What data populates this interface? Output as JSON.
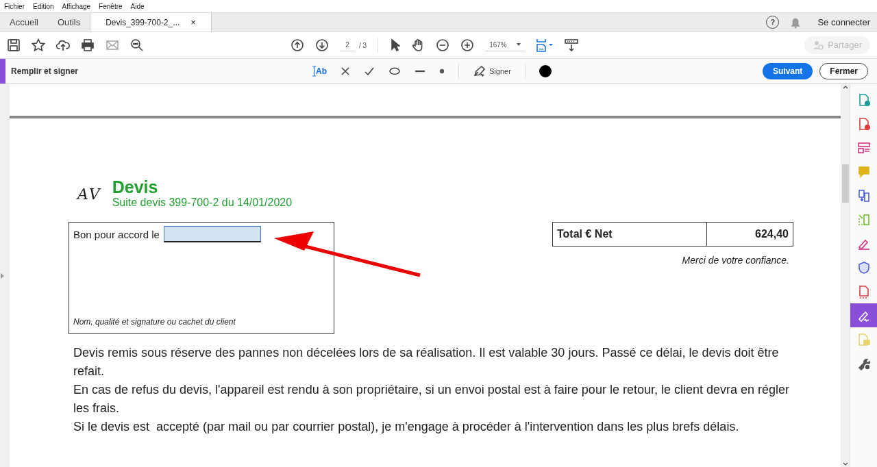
{
  "menu": [
    "Fichier",
    "Edition",
    "Affichage",
    "Fenêtre",
    "Aide"
  ],
  "tabs": [
    {
      "label": "Accueil",
      "selected": false
    },
    {
      "label": "Outils",
      "selected": false
    },
    {
      "label": "Devis_399-700-2_...",
      "selected": true,
      "close": "×"
    }
  ],
  "account": {
    "help": "?",
    "sign_in": "Se connecter"
  },
  "toolbar": {
    "page": "2",
    "page_total": "/ 3",
    "zoom": "167%",
    "share": "Partager",
    "share_disabled": true
  },
  "fill_sign": {
    "title": "Remplir et signer",
    "text_tool": "Ab",
    "sign": "Signer",
    "next": "Suivant",
    "close": "Fermer"
  },
  "document": {
    "logo": "AV",
    "title": "Devis",
    "subtitle": "Suite devis 399-700-2 du 14/01/2020",
    "agreement": {
      "label": "Bon pour accord le",
      "caption": "Nom, qualité et signature ou cachet du client"
    },
    "total": {
      "label": "Total € Net",
      "value": "624,40"
    },
    "thanks": "Merci de votre confiance.",
    "paragraphs": [
      "Devis remis sous réserve des pannes non décelées lors de sa réalisation. Il est valable 30 jours. Passé ce délai, le devis doit être refait.",
      "En cas de refus du devis, l'appareil est rendu à son propriétaire, si un envoi postal est à faire pour le retour, le client devra en régler les frais.",
      "Si le devis est  accepté (par mail ou par courrier postal), je m'engage à procéder à l'intervention dans les plus brefs délais."
    ]
  },
  "tool_panel": [
    {
      "kind": "export",
      "selected": false
    },
    {
      "kind": "create",
      "selected": false
    },
    {
      "kind": "organize",
      "selected": false
    },
    {
      "kind": "comment",
      "selected": false
    },
    {
      "kind": "combine",
      "selected": false
    },
    {
      "kind": "crop",
      "selected": false
    },
    {
      "kind": "edit",
      "selected": false
    },
    {
      "kind": "protect",
      "selected": false
    },
    {
      "kind": "compress",
      "selected": false
    },
    {
      "kind": "sign",
      "selected": true
    },
    {
      "kind": "review",
      "selected": false
    },
    {
      "kind": "more",
      "selected": false
    }
  ]
}
